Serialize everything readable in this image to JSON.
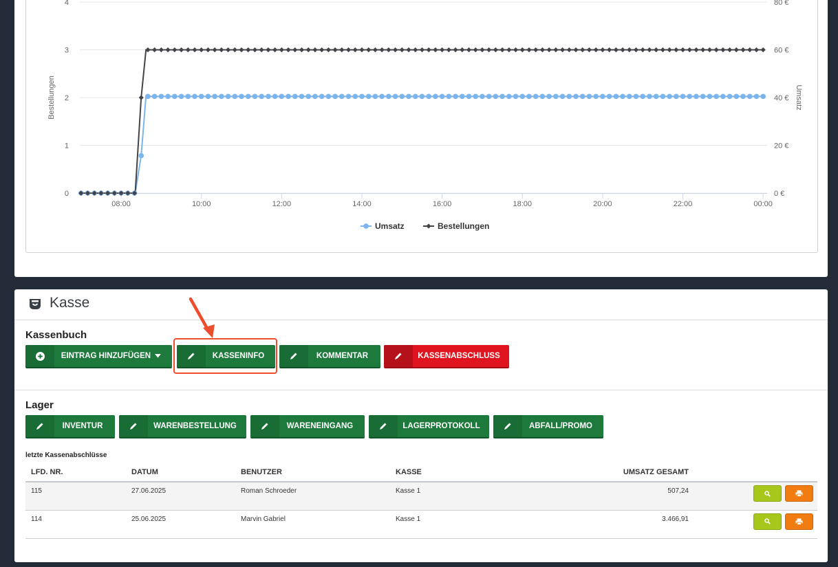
{
  "chart_data": {
    "type": "line",
    "y_left_label": "Bestellungen",
    "y_right_label": "Umsatz",
    "y_left_ticks": [
      "0",
      "1",
      "2",
      "3",
      "4"
    ],
    "y_right_ticks": [
      "0 €",
      "20 €",
      "40 €",
      "60 €",
      "80 €"
    ],
    "x_ticks": [
      "08:00",
      "10:00",
      "12:00",
      "14:00",
      "16:00",
      "18:00",
      "20:00",
      "22:00",
      "00:00"
    ],
    "ylim_left": [
      0,
      4
    ],
    "ylim_right": [
      0,
      80
    ],
    "xlim_hours": [
      6.97,
      24.1
    ],
    "grid": true,
    "legend_position": "bottom",
    "series": [
      {
        "name": "Umsatz",
        "axis": "right",
        "color": "#7cb5ec",
        "points": [
          [
            7.0,
            0
          ],
          [
            8.35,
            0
          ],
          [
            8.5,
            15.7
          ],
          [
            8.62,
            40.5
          ],
          [
            24.0,
            40.5
          ]
        ]
      },
      {
        "name": "Bestellungen",
        "axis": "left",
        "color": "#434348",
        "points": [
          [
            7.0,
            0
          ],
          [
            8.35,
            0
          ],
          [
            8.5,
            2
          ],
          [
            8.62,
            3
          ],
          [
            24.0,
            3
          ]
        ]
      }
    ]
  },
  "kasse": {
    "title": "Kasse",
    "kassenbuch": {
      "title": "Kassenbuch",
      "buttons": [
        {
          "label": "EINTRAG HINZUFÜGEN"
        },
        {
          "label": "KASSENINFO"
        },
        {
          "label": "KOMMENTAR"
        },
        {
          "label": "KASSENABSCHLUSS"
        }
      ]
    },
    "lager": {
      "title": "Lager",
      "buttons": [
        {
          "label": "INVENTUR"
        },
        {
          "label": "WARENBESTELLUNG"
        },
        {
          "label": "WARENEINGANG"
        },
        {
          "label": "LAGERPROTOKOLL"
        },
        {
          "label": "ABFALL/PROMO"
        }
      ]
    },
    "table": {
      "title": "letzte Kassenabschlüsse",
      "headers": [
        "LFD. NR.",
        "DATUM",
        "BENUTZER",
        "KASSE",
        "UMSATZ GESAMT"
      ],
      "rows": [
        [
          "115",
          "27.06.2025",
          "Roman Schroeder",
          "Kasse 1",
          "507,24"
        ],
        [
          "114",
          "25.06.2025",
          "Marvin Gabriel",
          "Kasse 1",
          "3.466,91"
        ]
      ]
    }
  }
}
